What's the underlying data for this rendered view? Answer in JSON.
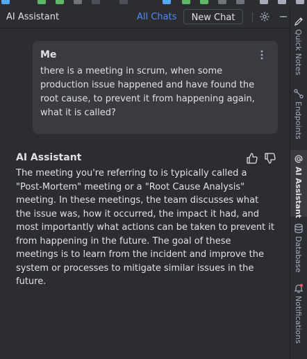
{
  "header": {
    "title": "AI Assistant",
    "all_chats_label": "All Chats",
    "new_chat_label": "New Chat"
  },
  "messages": [
    {
      "author": "Me",
      "text": "there is a meeting in scrum, when some production issue happened and have found the root cause, to prevent it from happening again, what it is called?"
    },
    {
      "author": "AI Assistant",
      "text": "The meeting you're referring to is typically called a \"Post-Mortem\" meeting or a \"Root Cause Analysis\" meeting. In these meetings, the team discusses what the issue was, how it occurred, the impact it had, and most importantly what actions can be taken to prevent it from happening in the future. The goal of these meetings is to learn from the incident and improve the system or processes to mitigate similar issues in the future."
    }
  ],
  "right_strip": {
    "tabs": [
      {
        "label": "Quick Notes",
        "icon": "edit-icon",
        "active": false
      },
      {
        "label": "Endpoints",
        "icon": "endpoints-icon",
        "active": false
      },
      {
        "label": "AI Assistant",
        "icon": "at-icon",
        "active": true
      },
      {
        "label": "Database",
        "icon": "database-icon",
        "active": false
      },
      {
        "label": "Notifications",
        "icon": "bell-icon",
        "active": false
      }
    ]
  },
  "colors": {
    "background": "#2b2d30",
    "bubble": "#393b40",
    "text": "#dfe1e5",
    "link": "#548af7",
    "muted": "#a8adbd",
    "border": "#1e1f22",
    "notification_dot": "#e55765"
  }
}
